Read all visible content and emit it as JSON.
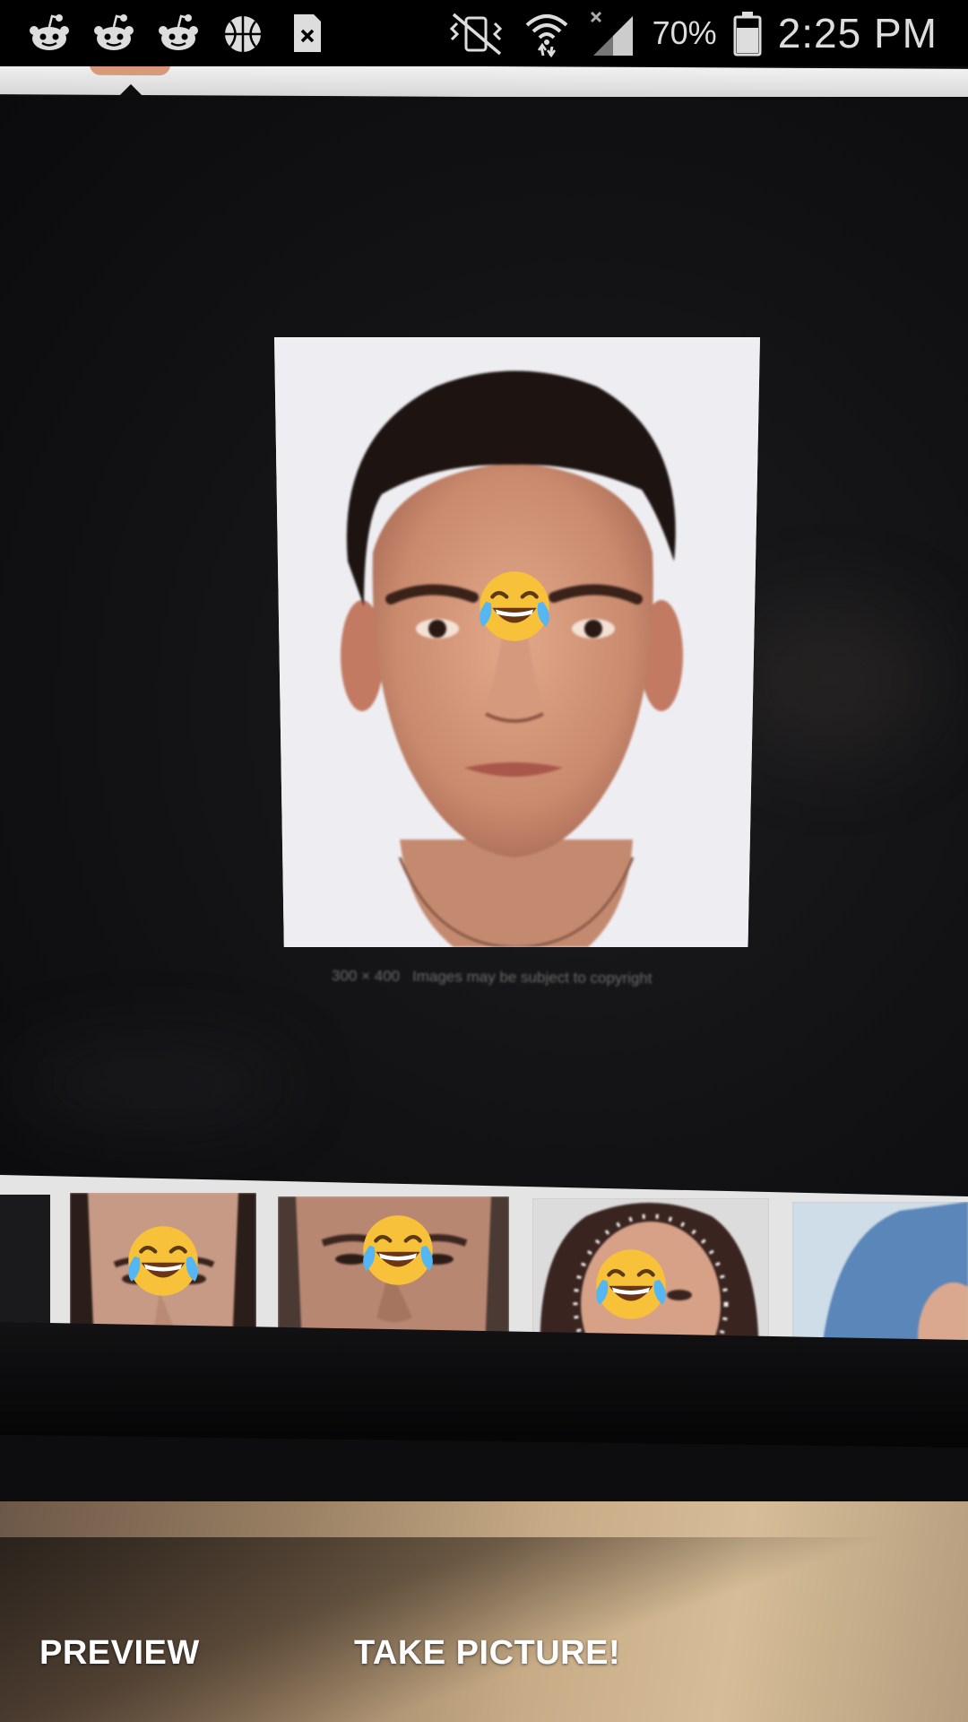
{
  "status_bar": {
    "notification_icons": [
      "reddit-icon",
      "reddit-icon",
      "reddit-icon",
      "basketball-icon",
      "file-close-icon"
    ],
    "system_icons": [
      "vibrate-mute-icon",
      "wifi-icon",
      "signal-icon",
      "battery-icon"
    ],
    "battery_percent": "70%",
    "time": "2:25 PM"
  },
  "screen": {
    "image_caption_size": "300 × 400",
    "image_caption_notice": "Images may be subject to copyright"
  },
  "overlay": {
    "emoji": "face-with-tears-of-joy"
  },
  "camera_controls": {
    "preview_label": "PREVIEW",
    "take_picture_label": "TAKE PICTURE!"
  },
  "colors": {
    "status_bar_bg": "#000000",
    "screen_bg": "#141416",
    "button_text": "#ffffff",
    "emoji_face": "#f7c23a"
  }
}
